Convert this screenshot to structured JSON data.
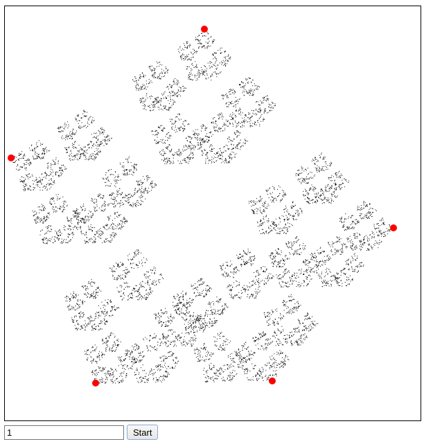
{
  "canvas": {
    "background": "#ffffff",
    "point_color": "#000000",
    "vertex_color": "#ff0000",
    "vertex_count": 5
  },
  "controls": {
    "iterations_value": "1",
    "start_label": "Start"
  }
}
